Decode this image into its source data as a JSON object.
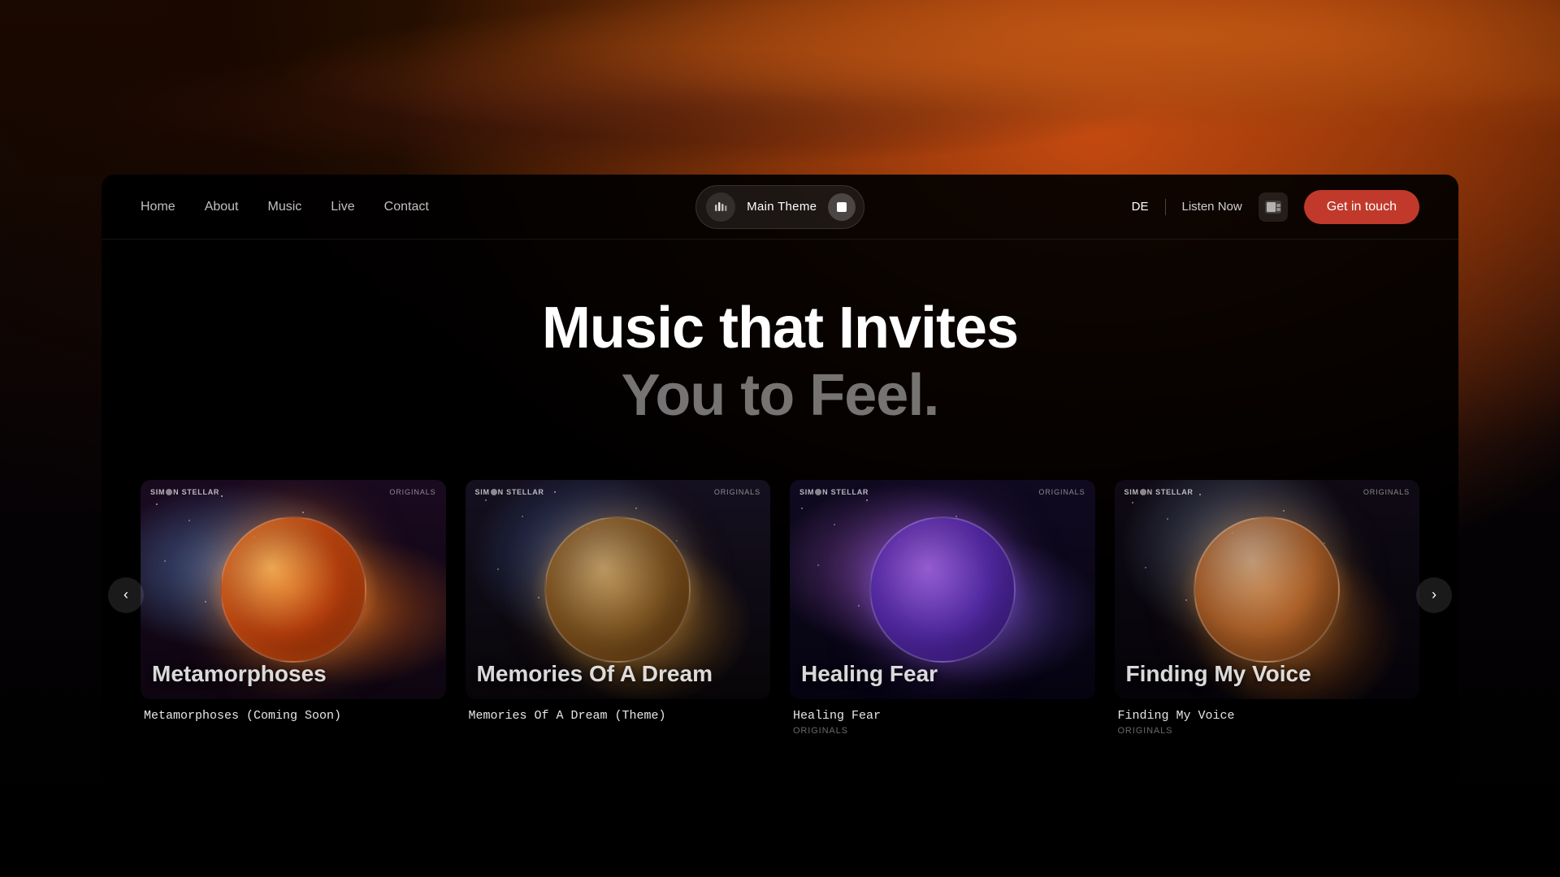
{
  "background": {
    "alt": "Space nebula background"
  },
  "navbar": {
    "links": [
      {
        "label": "Home",
        "id": "home"
      },
      {
        "label": "About",
        "id": "about"
      },
      {
        "label": "Music",
        "id": "music"
      },
      {
        "label": "Live",
        "id": "live"
      },
      {
        "label": "Contact",
        "id": "contact"
      }
    ],
    "player": {
      "title": "Main Theme",
      "stop_label": "Stop"
    },
    "lang": "DE",
    "listen_now": "Listen Now",
    "get_in_touch": "Get in touch"
  },
  "hero": {
    "line1": "Music that Invites",
    "line2": "You to Feel."
  },
  "albums": [
    {
      "id": "metamorphoses",
      "title_overlay": "Metamorphoses",
      "name": "Metamorphoses (Coming Soon)",
      "category": "",
      "brand": "SIMON STELLAR",
      "type": "ORIGINALS",
      "art_class": "album-art-1",
      "planet_class": "album-planet-1"
    },
    {
      "id": "memories-of-a-dream",
      "title_overlay": "Memories Of A Dream",
      "name": "Memories Of A Dream (Theme)",
      "category": "",
      "brand": "SIMON STELLAR",
      "type": "ORIGINALS",
      "art_class": "album-art-2",
      "planet_class": "album-planet-2"
    },
    {
      "id": "healing-fear",
      "title_overlay": "Healing Fear",
      "name": "Healing Fear",
      "category": "ORIGINALS",
      "brand": "SIMON STELLAR",
      "type": "ORIGINALS",
      "art_class": "album-art-3",
      "planet_class": "album-planet-3"
    },
    {
      "id": "finding-my-voice",
      "title_overlay": "Finding My Voice",
      "name": "Finding My Voice",
      "category": "ORIGINALS",
      "brand": "SIMON STELLAR",
      "type": "ORIGINALS",
      "art_class": "album-art-4",
      "planet_class": "album-planet-4"
    }
  ]
}
